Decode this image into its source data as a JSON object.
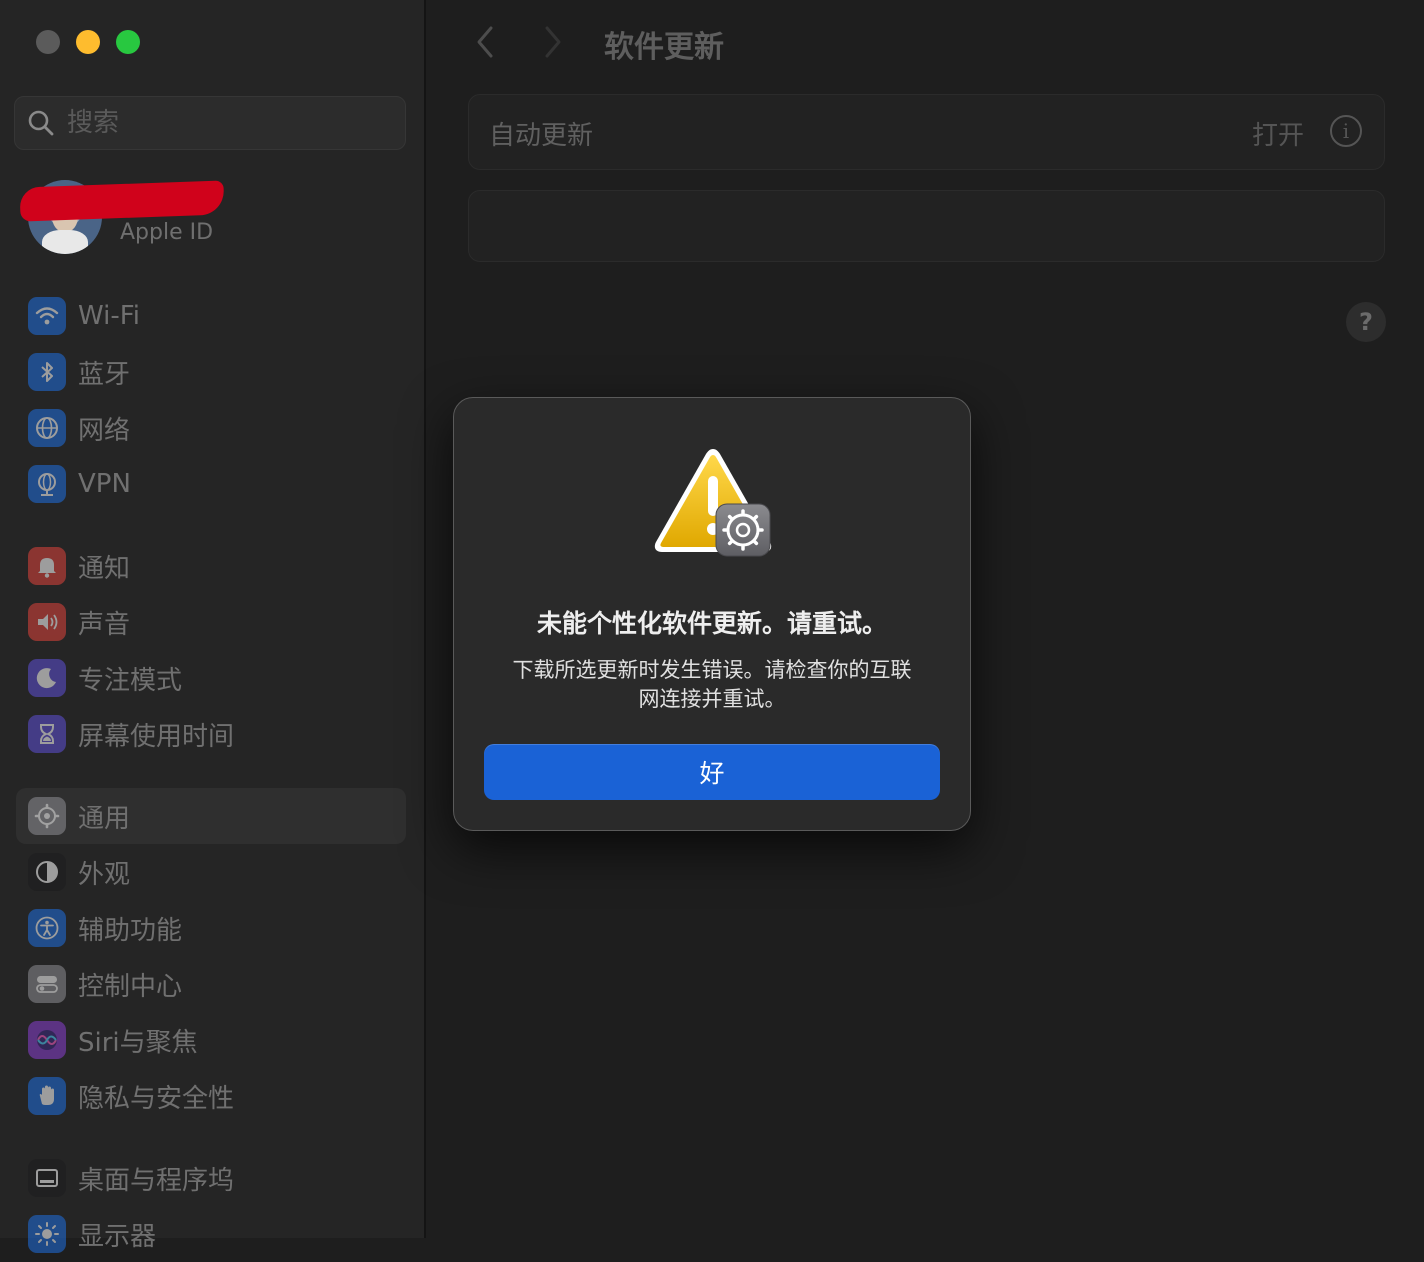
{
  "window": {
    "title": "软件更新"
  },
  "search": {
    "placeholder": "搜索"
  },
  "account": {
    "subtitle": "Apple ID"
  },
  "sidebar": {
    "groups": [
      [
        {
          "label": "Wi-Fi",
          "icon": "wifi-icon",
          "color": "#1e6fe0"
        },
        {
          "label": "蓝牙",
          "icon": "bluetooth-icon",
          "color": "#1e6fe0"
        },
        {
          "label": "网络",
          "icon": "globe-icon",
          "color": "#1e6fe0"
        },
        {
          "label": "VPN",
          "icon": "vpn-globe-icon",
          "color": "#1e6fe0"
        }
      ],
      [
        {
          "label": "通知",
          "icon": "bell-icon",
          "color": "#e0433b"
        },
        {
          "label": "声音",
          "icon": "speaker-icon",
          "color": "#e0433b"
        },
        {
          "label": "专注模式",
          "icon": "moon-icon",
          "color": "#5e4fd6"
        },
        {
          "label": "屏幕使用时间",
          "icon": "hourglass-icon",
          "color": "#5e4fd6"
        }
      ],
      [
        {
          "label": "通用",
          "icon": "gear-icon",
          "color": "#8e8e93",
          "active": true
        },
        {
          "label": "外观",
          "icon": "appearance-icon",
          "color": "#1c1c1e"
        },
        {
          "label": "辅助功能",
          "icon": "accessibility-icon",
          "color": "#1e6fe0"
        },
        {
          "label": "控制中心",
          "icon": "toggles-icon",
          "color": "#8e8e93"
        },
        {
          "label": "Siri与聚焦",
          "icon": "siri-icon",
          "color": "#8a3fd1"
        },
        {
          "label": "隐私与安全性",
          "icon": "hand-icon",
          "color": "#1e6fe0"
        }
      ],
      [
        {
          "label": "桌面与程序坞",
          "icon": "dock-icon",
          "color": "#1c1c1e"
        },
        {
          "label": "显示器",
          "icon": "sun-icon",
          "color": "#1e6fe0"
        }
      ]
    ]
  },
  "main": {
    "auto_update": {
      "label": "自动更新",
      "value": "打开",
      "info_glyph": "i"
    },
    "help_glyph": "?"
  },
  "dialog": {
    "title": "未能个性化软件更新。请重试。",
    "message": "下载所选更新时发生错误。请检查你的互联网连接并重试。",
    "ok_label": "好",
    "accent": "#1a62d6"
  },
  "colors": {
    "traffic_close": "#5b5b5b",
    "traffic_minimize": "#febc2e",
    "traffic_zoom": "#28c840"
  }
}
